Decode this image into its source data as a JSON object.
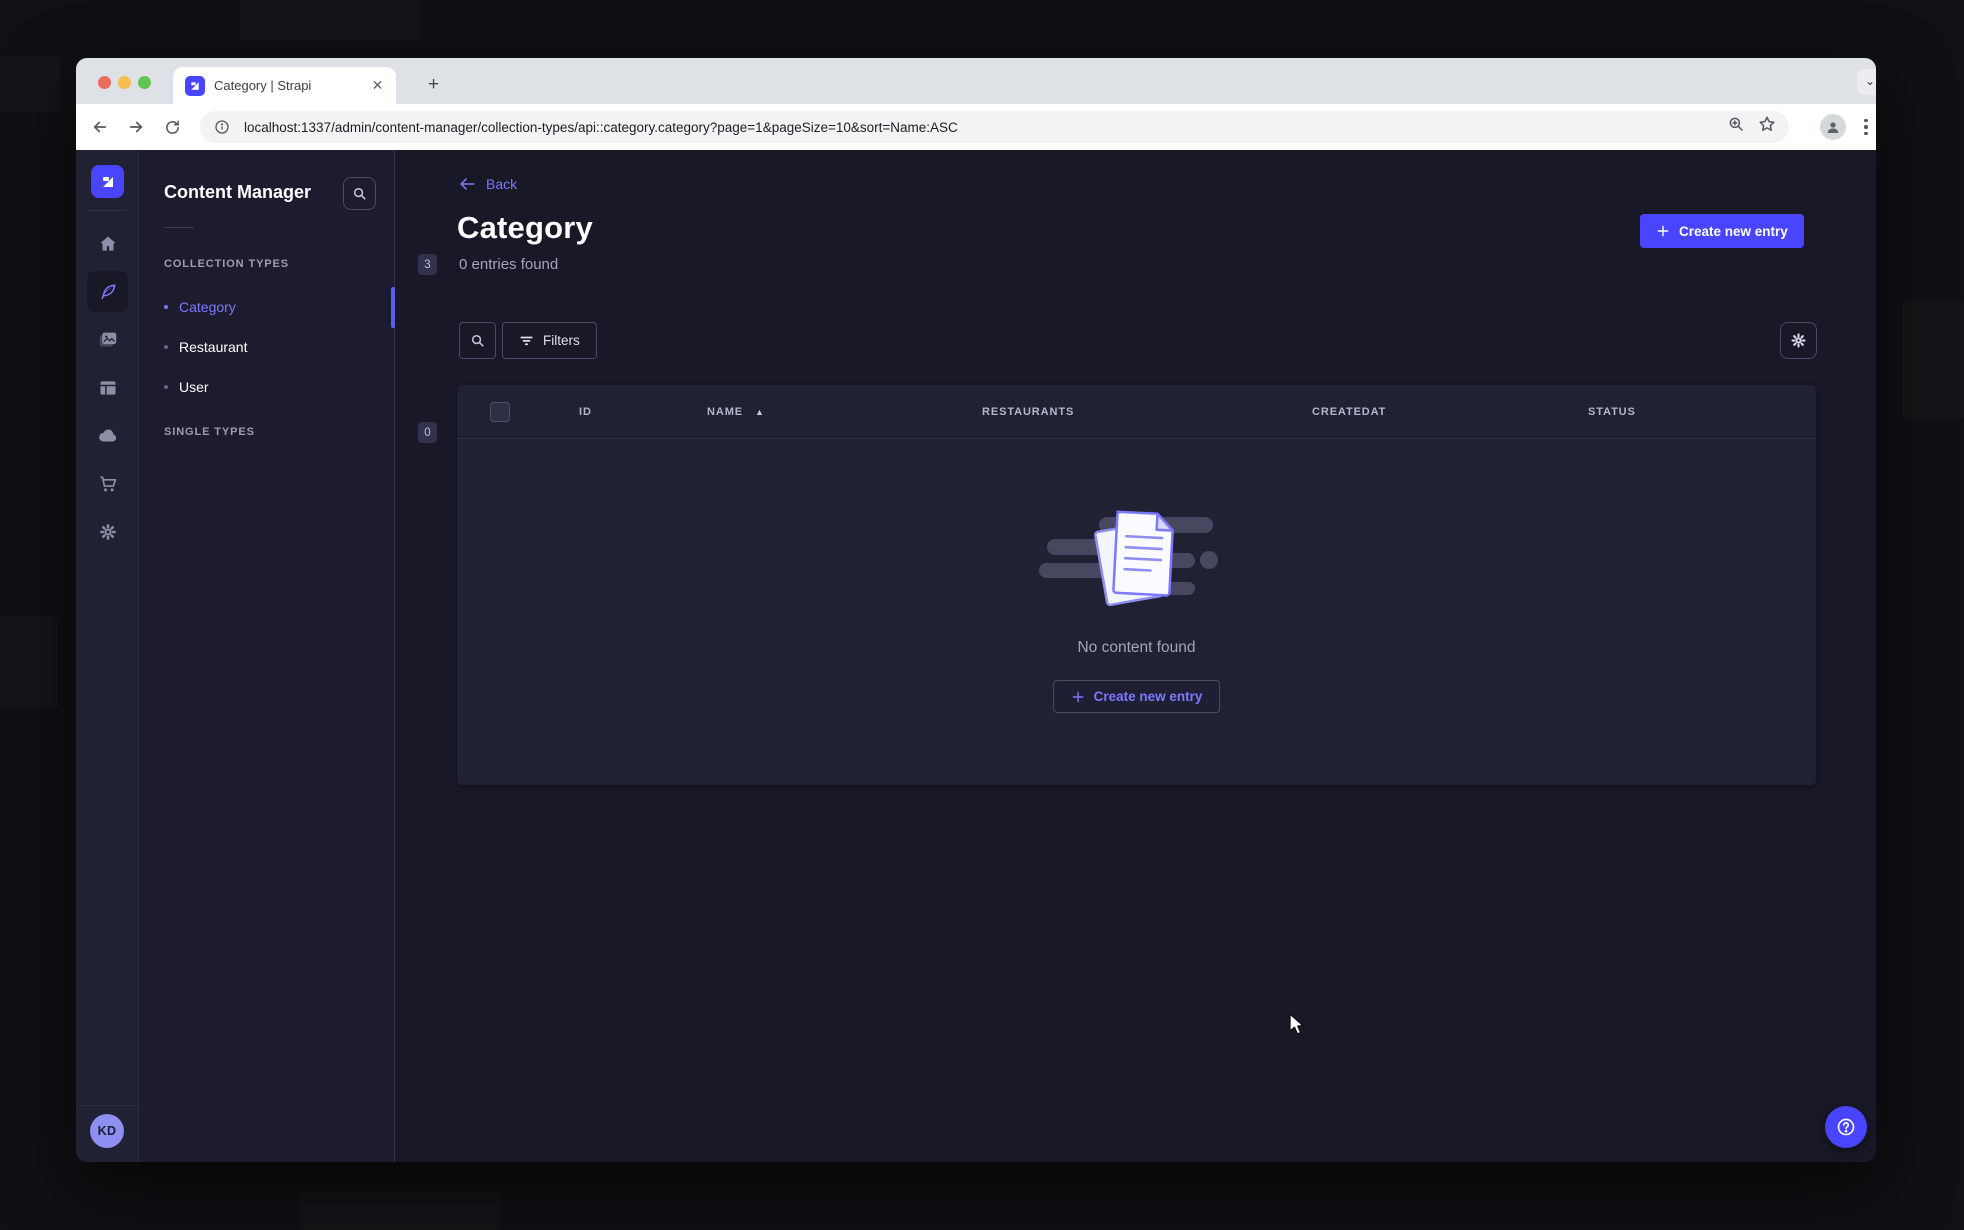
{
  "browser": {
    "tab_title": "Category | Strapi",
    "url": "localhost:1337/admin/content-manager/collection-types/api::category.category?page=1&pageSize=10&sort=Name:ASC"
  },
  "sidebar": {
    "avatar_initials": "KD",
    "icons": [
      "strapi-logo",
      "home",
      "content-manager",
      "media-library",
      "content-type-builder",
      "cloud",
      "marketplace",
      "settings"
    ]
  },
  "subnav": {
    "title": "Content Manager",
    "sections": [
      {
        "label": "COLLECTION TYPES",
        "count": "3",
        "items": [
          {
            "label": "Category",
            "active": true
          },
          {
            "label": "Restaurant",
            "active": false
          },
          {
            "label": "User",
            "active": false
          }
        ]
      },
      {
        "label": "SINGLE TYPES",
        "count": "0",
        "items": []
      }
    ]
  },
  "main": {
    "back_label": "Back",
    "title": "Category",
    "subtitle": "0 entries found",
    "create_button_label": "Create new entry",
    "filters_button_label": "Filters",
    "table": {
      "columns": [
        "ID",
        "NAME",
        "RESTAURANTS",
        "CREATEDAT",
        "STATUS"
      ],
      "sorted_column": "NAME",
      "sort_direction": "asc",
      "sort_glyph": "▲",
      "empty_text": "No content found",
      "empty_create_button_label": "Create new entry"
    }
  },
  "colors": {
    "accent": "#4945ff",
    "accent_text": "#7b79ff",
    "page_bg": "#181826",
    "surface": "#212134",
    "border": "#32324d",
    "muted_text": "#a5a5ba"
  }
}
